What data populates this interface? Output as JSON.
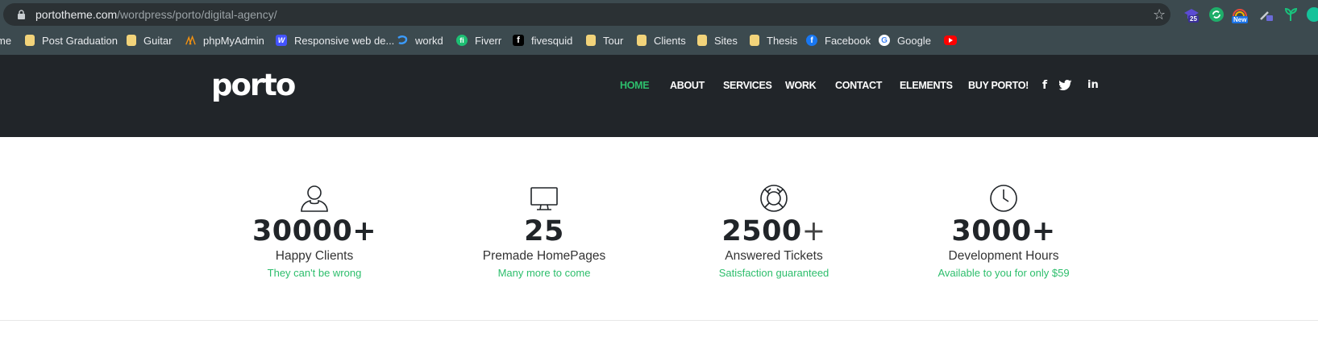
{
  "browser": {
    "url_host": "portotheme.com",
    "url_path": "/wordpress/porto/digital-agency/",
    "extension_badges": {
      "first": "25",
      "third": "New"
    },
    "bookmarks": [
      {
        "label": "me",
        "icon": "folder-icon"
      },
      {
        "label": "Post Graduation",
        "icon": "folder-icon"
      },
      {
        "label": "Guitar",
        "icon": "folder-icon"
      },
      {
        "label": "phpMyAdmin",
        "icon": "phpmyadmin-icon"
      },
      {
        "label": "Responsive web de...",
        "icon": "webflow-icon"
      },
      {
        "label": "workd",
        "icon": "workd-icon"
      },
      {
        "label": "Fiverr",
        "icon": "fiverr-icon"
      },
      {
        "label": "fivesquid",
        "icon": "fivesquid-icon"
      },
      {
        "label": "Tour",
        "icon": "folder-icon"
      },
      {
        "label": "Clients",
        "icon": "folder-icon"
      },
      {
        "label": "Sites",
        "icon": "folder-icon"
      },
      {
        "label": "Thesis",
        "icon": "folder-icon"
      },
      {
        "label": "Facebook",
        "icon": "facebook-icon"
      },
      {
        "label": "Google",
        "icon": "google-icon"
      }
    ]
  },
  "header": {
    "logo": "porto",
    "nav": [
      {
        "label": "HOME",
        "active": true
      },
      {
        "label": "ABOUT"
      },
      {
        "label": "SERVICES"
      },
      {
        "label": "WORK"
      },
      {
        "label": "CONTACT"
      },
      {
        "label": "ELEMENTS"
      },
      {
        "label": "BUY PORTO!"
      }
    ],
    "social": [
      "facebook-icon",
      "twitter-icon",
      "linkedin-icon"
    ],
    "social_glyphs": {
      "facebook": "f",
      "linkedin": "in"
    }
  },
  "counters": [
    {
      "number": "30000",
      "suffix": "+",
      "label": "Happy Clients",
      "sub": "They can't be wrong",
      "icon": "user-icon"
    },
    {
      "number": "25",
      "suffix": "",
      "label": "Premade HomePages",
      "sub": "Many more to come",
      "icon": "monitor-icon"
    },
    {
      "number": "2500",
      "suffix": "+",
      "label": "Answered Tickets",
      "sub": "Satisfaction guaranteed",
      "icon": "lifebuoy-icon"
    },
    {
      "number": "3000",
      "suffix": "+",
      "label": "Development Hours",
      "sub": "Available to you for only $59",
      "icon": "clock-icon"
    }
  ],
  "colors": {
    "accent": "#2dbe6c",
    "header_bg": "#212529",
    "chrome_bg": "#3c4a4f"
  }
}
